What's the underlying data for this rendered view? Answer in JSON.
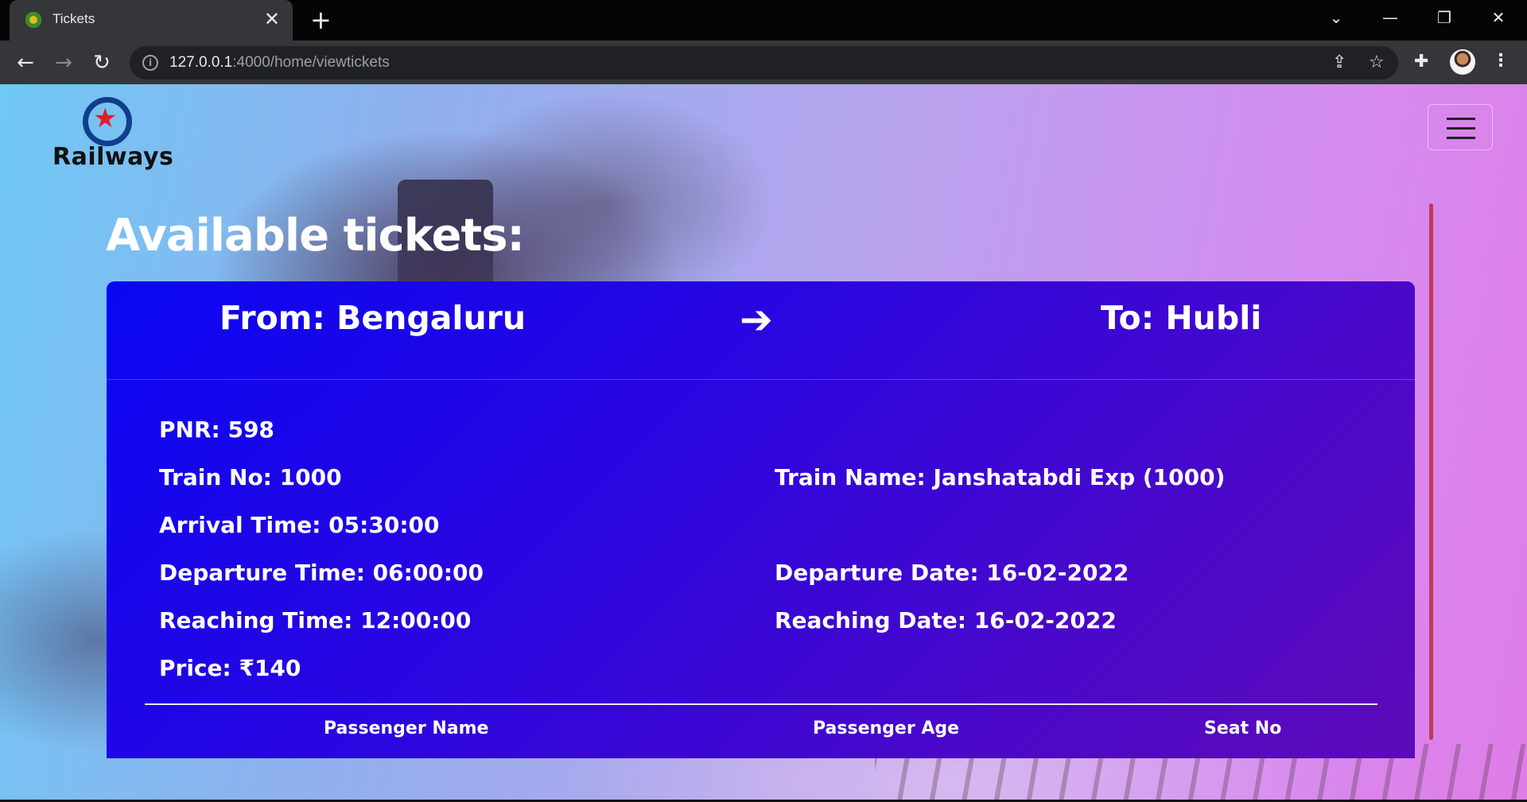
{
  "browser": {
    "tab_title": "Tickets",
    "tab_close": "✕",
    "new_tab": "+",
    "url_host": "127.0.0.1",
    "url_rest": ":4000/home/viewtickets",
    "controls": {
      "minimize": "—",
      "restore": "❐",
      "close": "✕",
      "tab_search": "⌄"
    },
    "nav": {
      "back": "←",
      "forward": "→",
      "reload": "↻"
    },
    "icons": [
      "info-icon",
      "share-icon",
      "star-icon",
      "extensions-icon",
      "profile-avatar",
      "menu-icon"
    ]
  },
  "brand": {
    "logo_text": "Railways",
    "accent": "#e21d25",
    "ring_color": "#0f3f8c"
  },
  "page": {
    "heading": "Available tickets:"
  },
  "ticket": {
    "from": "From: Bengaluru",
    "arrow": "➔",
    "to": "To: Hubli",
    "pnr": "PNR: 598",
    "train_no": "Train No: 1000",
    "train_name": "Train Name: Janshatabdi Exp (1000)",
    "arrival_time": "Arrival Time: 05:30:00",
    "departure_time": "Departure Time: 06:00:00",
    "departure_date": "Departure Date: 16-02-2022",
    "reaching_time": "Reaching Time: 12:00:00",
    "reaching_date": "Reaching Date: 16-02-2022",
    "price": "Price: ₹140",
    "columns": [
      "Passenger Name",
      "Passenger Age",
      "Seat No"
    ],
    "card_color_start": "#0a06f3",
    "card_color_end": "#5e0bb8"
  }
}
